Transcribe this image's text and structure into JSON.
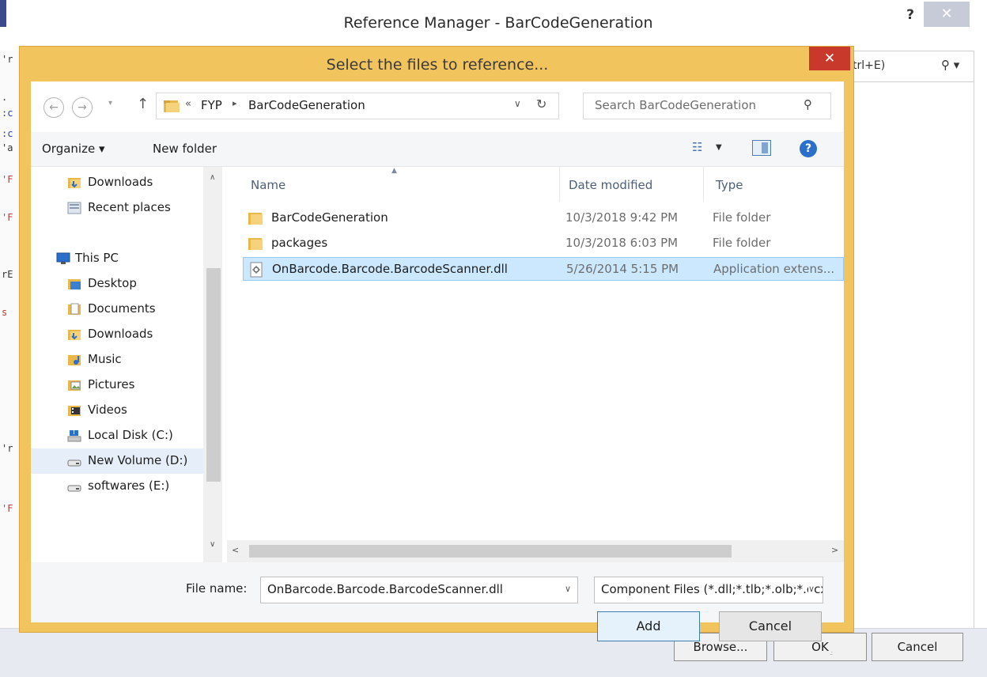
{
  "outer_window": {
    "title": "Reference Manager - BarCodeGeneration",
    "help_label": "?",
    "close_label": "✕",
    "search_text": "trl+E)",
    "browse_label": "Browse...",
    "ok_label": "OK",
    "cancel_label": "Cancel",
    "strip_glyphs": [
      "'r",
      ".",
      ":c",
      ":c",
      "'a",
      "'F",
      "'F",
      "rE",
      "s",
      "'r",
      "'F"
    ]
  },
  "dialog": {
    "title": "Select the files to reference...",
    "close_label": "✕",
    "accent_color": "#f2c45e",
    "address": {
      "overflow": "«",
      "parts": [
        "FYP",
        "BarCodeGeneration"
      ],
      "separator": "▸"
    },
    "search_placeholder": "Search BarCodeGeneration",
    "toolbar": {
      "organize_label": "Organize ▾",
      "new_folder_label": "New folder"
    },
    "nav_items": [
      {
        "label": "Downloads",
        "icon": "downloads-folder-icon"
      },
      {
        "label": "Recent places",
        "icon": "recent-places-icon"
      },
      {
        "label": "This PC",
        "icon": "computer-icon"
      },
      {
        "label": "Desktop",
        "icon": "desktop-folder-icon"
      },
      {
        "label": "Documents",
        "icon": "documents-folder-icon"
      },
      {
        "label": "Downloads",
        "icon": "downloads-folder-icon"
      },
      {
        "label": "Music",
        "icon": "music-folder-icon"
      },
      {
        "label": "Pictures",
        "icon": "pictures-folder-icon"
      },
      {
        "label": "Videos",
        "icon": "videos-folder-icon"
      },
      {
        "label": "Local Disk (C:)",
        "icon": "local-disk-icon"
      },
      {
        "label": "New Volume (D:)",
        "icon": "drive-icon",
        "selected": true
      },
      {
        "label": "softwares (E:)",
        "icon": "drive-icon"
      }
    ],
    "columns": {
      "name": "Name",
      "date": "Date modified",
      "type": "Type"
    },
    "files": [
      {
        "name": "BarCodeGeneration",
        "date": "10/3/2018 9:42 PM",
        "type": "File folder",
        "icon": "folder-icon"
      },
      {
        "name": "packages",
        "date": "10/3/2018 6:03 PM",
        "type": "File folder",
        "icon": "folder-icon"
      },
      {
        "name": "OnBarcode.Barcode.BarcodeScanner.dll",
        "date": "5/26/2014 5:15 PM",
        "type": "Application extens...",
        "icon": "dll-file-icon",
        "selected": true
      }
    ],
    "file_name_label": "File name:",
    "file_name_value": "OnBarcode.Barcode.BarcodeScanner.dll",
    "filter_value": "Component Files (*.dll;*.tlb;*.olb;*.ocx;*.exe;*.manifest)",
    "add_label": "Add",
    "cancel_label": "Cancel"
  }
}
